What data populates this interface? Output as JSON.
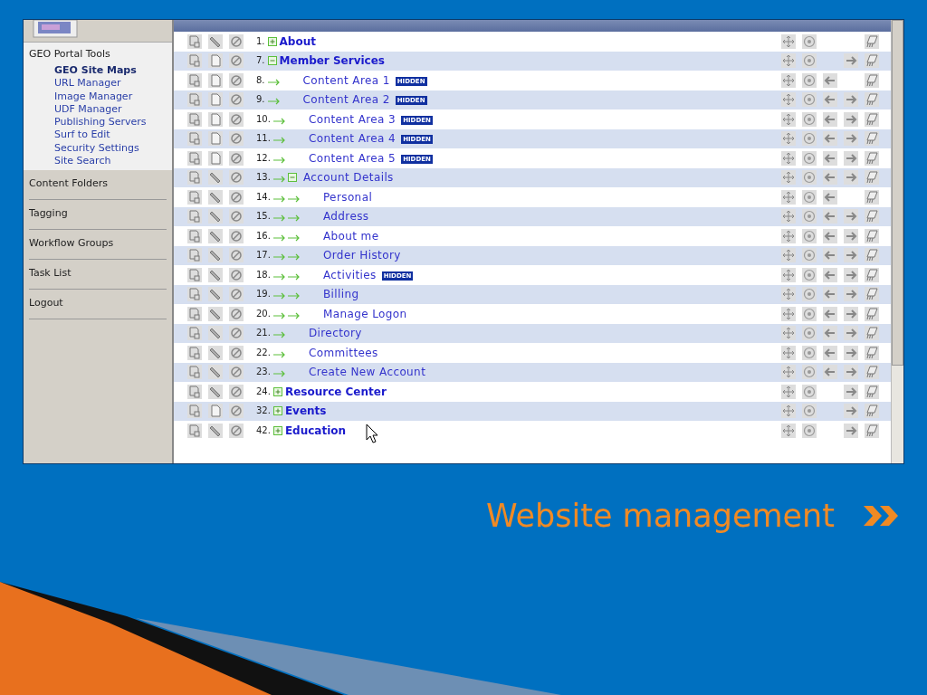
{
  "sidebar": {
    "tools_title": "GEO Portal Tools",
    "tools": [
      {
        "label": "GEO Site Maps",
        "selected": true
      },
      {
        "label": "URL Manager",
        "selected": false
      },
      {
        "label": "Image Manager",
        "selected": false
      },
      {
        "label": "UDF Manager",
        "selected": false
      },
      {
        "label": "Publishing Servers",
        "selected": false
      },
      {
        "label": "Surf to Edit",
        "selected": false
      },
      {
        "label": "Security Settings",
        "selected": false
      },
      {
        "label": "Site Search",
        "selected": false
      }
    ],
    "sections": [
      "Content Folders",
      "Tagging",
      "Workflow Groups",
      "Task List",
      "Logout"
    ]
  },
  "rows": [
    {
      "number": "1.",
      "label": "About",
      "expanded": false,
      "kind": "link",
      "can_outdent": false,
      "can_indent": false
    },
    {
      "number": "7.",
      "label": "Member Services",
      "expanded": true,
      "kind": "page",
      "can_outdent": false,
      "can_indent": true,
      "children": [
        {
          "number": "8.",
          "label": "Content Area 1",
          "badge": "HIDDEN",
          "kind": "page",
          "can_outdent": true,
          "can_indent": false
        },
        {
          "number": "9.",
          "label": "Content Area 2",
          "badge": "HIDDEN",
          "kind": "page",
          "can_outdent": true,
          "can_indent": true
        },
        {
          "number": "10.",
          "label": "Content Area 3",
          "badge": "HIDDEN",
          "kind": "page",
          "can_outdent": true,
          "can_indent": true
        },
        {
          "number": "11.",
          "label": "Content Area 4",
          "badge": "HIDDEN",
          "kind": "page",
          "can_outdent": true,
          "can_indent": true
        },
        {
          "number": "12.",
          "label": "Content Area 5",
          "badge": "HIDDEN",
          "kind": "page",
          "can_outdent": true,
          "can_indent": true
        },
        {
          "number": "13.",
          "label": "Account Details",
          "expanded": true,
          "kind": "link",
          "can_outdent": true,
          "can_indent": true,
          "children": [
            {
              "number": "14.",
              "label": "Personal",
              "kind": "link",
              "can_outdent": true,
              "can_indent": false
            },
            {
              "number": "15.",
              "label": "Address",
              "kind": "link",
              "can_outdent": true,
              "can_indent": true
            },
            {
              "number": "16.",
              "label": "About me",
              "kind": "link",
              "can_outdent": true,
              "can_indent": true
            },
            {
              "number": "17.",
              "label": "Order History",
              "kind": "link",
              "can_outdent": true,
              "can_indent": true
            },
            {
              "number": "18.",
              "label": "Activities",
              "badge": "HIDDEN",
              "kind": "link",
              "can_outdent": true,
              "can_indent": true
            },
            {
              "number": "19.",
              "label": "Billing",
              "kind": "link",
              "can_outdent": true,
              "can_indent": true
            },
            {
              "number": "20.",
              "label": "Manage Logon",
              "kind": "link",
              "can_outdent": true,
              "can_indent": true
            }
          ]
        },
        {
          "number": "21.",
          "label": "Directory",
          "kind": "link",
          "can_outdent": true,
          "can_indent": true
        },
        {
          "number": "22.",
          "label": "Committees",
          "kind": "link",
          "can_outdent": true,
          "can_indent": true
        },
        {
          "number": "23.",
          "label": "Create New Account",
          "kind": "link",
          "can_outdent": true,
          "can_indent": true
        }
      ]
    },
    {
      "number": "24.",
      "label": "Resource Center",
      "expanded": false,
      "kind": "link",
      "can_outdent": false,
      "can_indent": true
    },
    {
      "number": "32.",
      "label": "Events",
      "expanded": false,
      "kind": "page",
      "can_outdent": false,
      "can_indent": true
    },
    {
      "number": "42.",
      "label": "Education",
      "expanded": false,
      "kind": "link",
      "can_outdent": false,
      "can_indent": true
    }
  ],
  "slide_title": "Website management"
}
